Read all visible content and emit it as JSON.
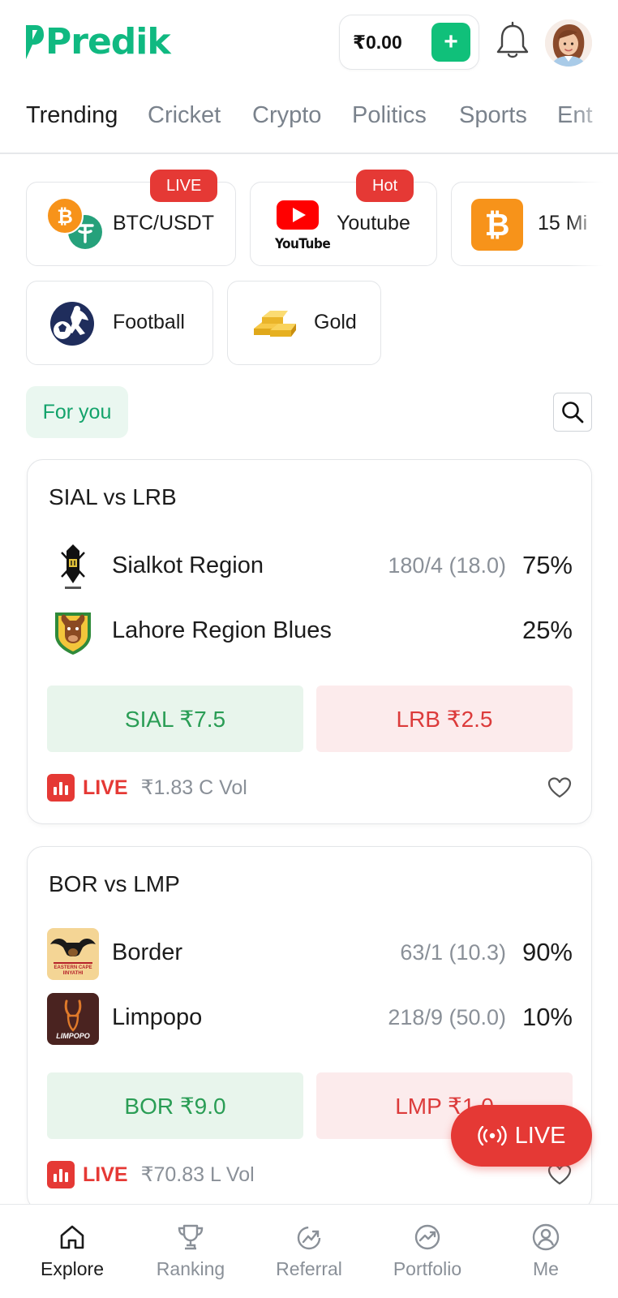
{
  "header": {
    "logo_text": "Predik",
    "wallet_amount": "₹0.00",
    "add_label": "+"
  },
  "tabs": [
    {
      "label": "Trending",
      "active": true
    },
    {
      "label": "Cricket"
    },
    {
      "label": "Crypto"
    },
    {
      "label": "Politics"
    },
    {
      "label": "Sports"
    },
    {
      "label": "Ent"
    }
  ],
  "categories": [
    {
      "label": "BTC/USDT",
      "badge": "LIVE",
      "icon": "btc-usdt-icon"
    },
    {
      "label": "Youtube",
      "badge": "Hot",
      "icon": "youtube-icon",
      "icon_caption": "YouTube"
    },
    {
      "label": "15 Mi",
      "icon": "bitcoin-icon"
    },
    {
      "label": "Football",
      "icon": "football-icon"
    },
    {
      "label": "Gold",
      "icon": "gold-bars-icon"
    }
  ],
  "feed": {
    "filter_label": "For you"
  },
  "markets": [
    {
      "title": "SIAL vs LRB",
      "teams": [
        {
          "name": "Sialkot Region",
          "score": "180/4 (18.0)",
          "pct": "75%"
        },
        {
          "name": "Lahore Region Blues",
          "score": "",
          "pct": "25%"
        }
      ],
      "buttons": {
        "yes": "SIAL ₹7.5",
        "no": "LRB ₹2.5"
      },
      "status": "LIVE",
      "volume": "₹1.83 C Vol"
    },
    {
      "title": "BOR vs LMP",
      "teams": [
        {
          "name": "Border",
          "score": "63/1 (10.3)",
          "pct": "90%",
          "logo_text": "EASTERN CAPE IINYATHI"
        },
        {
          "name": "Limpopo",
          "score": "218/9 (50.0)",
          "pct": "10%",
          "logo_text": "LIMPOPO"
        }
      ],
      "buttons": {
        "yes": "BOR ₹9.0",
        "no": "LMP ₹1.0"
      },
      "status": "LIVE",
      "volume": "₹70.83 L Vol"
    }
  ],
  "float_button": {
    "label": "LIVE"
  },
  "nav": [
    {
      "label": "Explore",
      "icon": "home-icon",
      "active": true
    },
    {
      "label": "Ranking",
      "icon": "trophy-icon"
    },
    {
      "label": "Referral",
      "icon": "referral-icon"
    },
    {
      "label": "Portfolio",
      "icon": "portfolio-icon"
    },
    {
      "label": "Me",
      "icon": "user-icon"
    }
  ],
  "colors": {
    "brand": "#10b981",
    "live_red": "#e53935",
    "yes_green": "#2a9d55",
    "no_red": "#dc3b3b"
  }
}
